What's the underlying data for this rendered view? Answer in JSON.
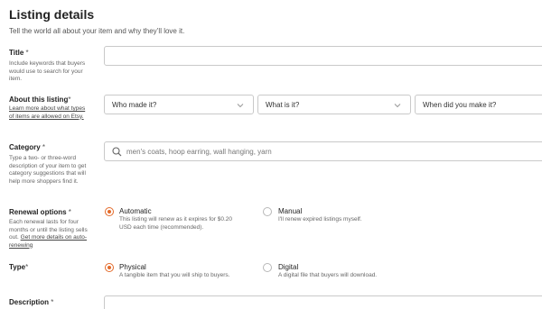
{
  "header": {
    "title": "Listing details",
    "subtitle": "Tell the world all about your item and why they’ll love it."
  },
  "title_field": {
    "label": "Title",
    "required": " *",
    "help": "Include keywords that buyers would use to search for your item.",
    "value": ""
  },
  "about": {
    "label": "About this listing",
    "required": "*",
    "help_link": "Learn more about what types of items are allowed on Etsy.",
    "selects": [
      {
        "value": "Who made it?"
      },
      {
        "value": "What is it?"
      },
      {
        "value": "When did you make it?"
      }
    ]
  },
  "category": {
    "label": "Category",
    "required": " *",
    "help": "Type a two- or three-word description of your item to get category suggestions that will help more shoppers find it.",
    "placeholder": "men's coats, hoop earring, wall hanging, yarn"
  },
  "renewal": {
    "label": "Renewal options",
    "required": " *",
    "help_text": "Each renewal lasts for four months or until the listing sells out.",
    "help_link": "Get more details on auto-renewing",
    "options": [
      {
        "title": "Automatic",
        "desc": "This listing will renew as it expires for $0.20 USD each time (recommended).",
        "selected": true
      },
      {
        "title": "Manual",
        "desc": "I'll renew expired listings myself.",
        "selected": false
      }
    ]
  },
  "type": {
    "label": "Type",
    "required": "*",
    "options": [
      {
        "title": "Physical",
        "desc": "A tangible item that you will ship to buyers.",
        "selected": true
      },
      {
        "title": "Digital",
        "desc": "A digital file that buyers will download.",
        "selected": false
      }
    ]
  },
  "description": {
    "label": "Description",
    "required": " *"
  },
  "colors": {
    "accent": "#e36a2a",
    "border": "#c9c9c9"
  }
}
